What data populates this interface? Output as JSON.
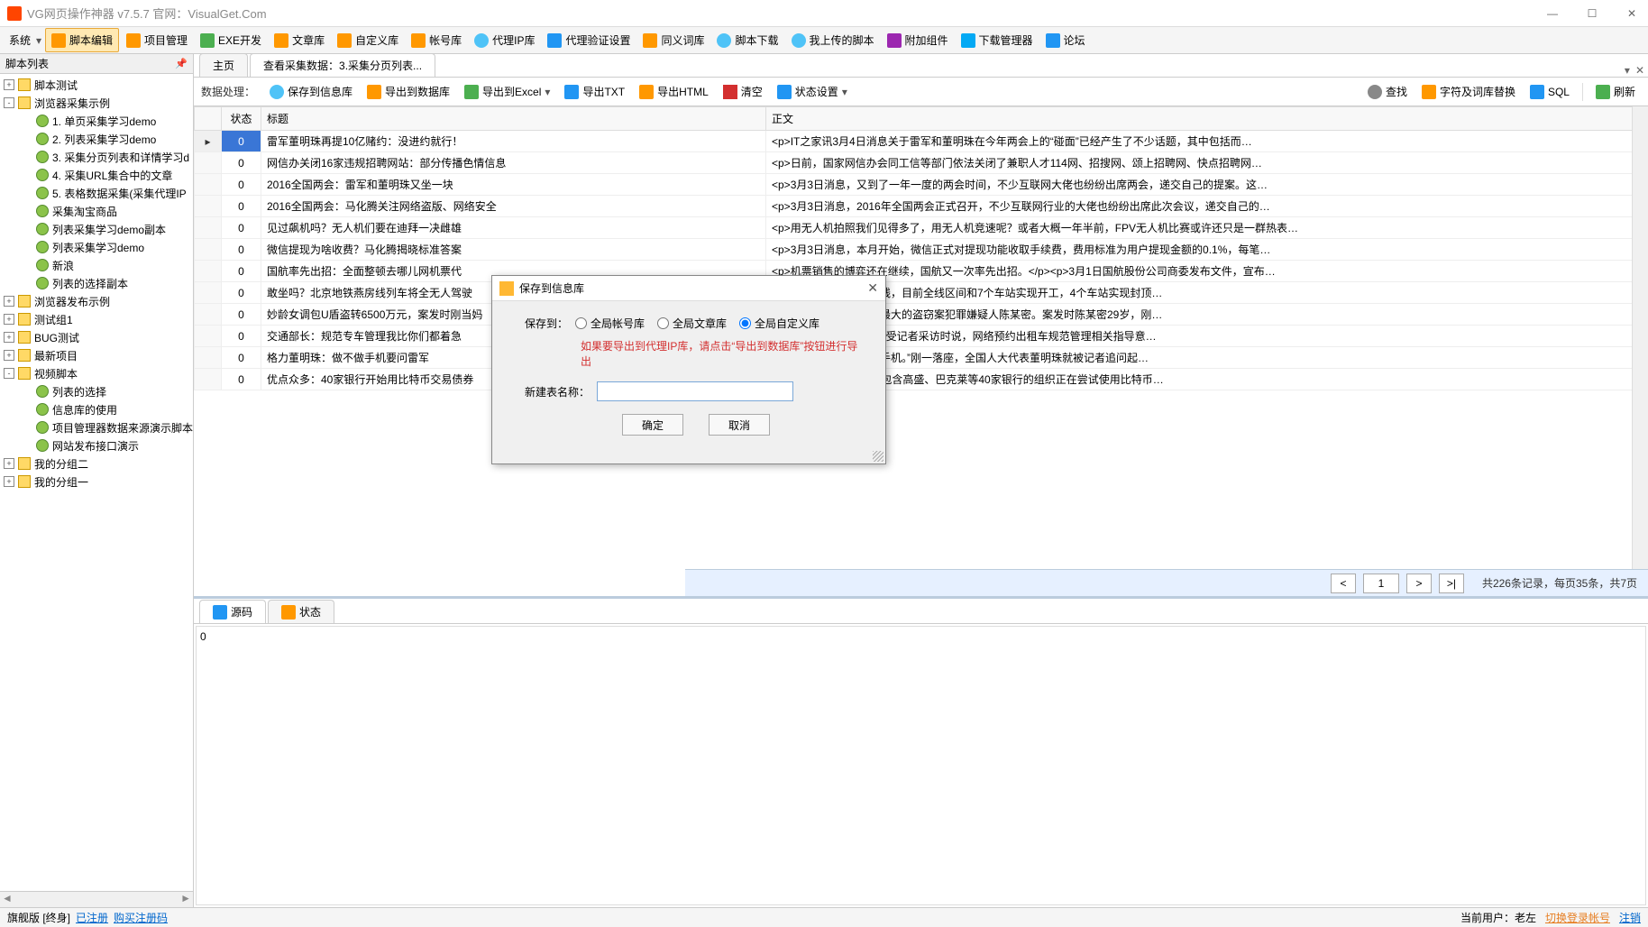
{
  "window": {
    "title": "VG网页操作神器 v7.5.7    官网：VisualGet.Com"
  },
  "menubar": {
    "system": "系统",
    "items": [
      "脚本编辑",
      "项目管理",
      "EXE开发",
      "文章库",
      "自定义库",
      "帐号库",
      "代理IP库",
      "代理验证设置",
      "同义词库",
      "脚本下载",
      "我上传的脚本",
      "附加组件",
      "下载管理器",
      "论坛"
    ]
  },
  "sidebar": {
    "title": "脚本列表",
    "nodes": [
      {
        "level": 0,
        "toggle": "+",
        "icon": "folder",
        "label": "脚本测试"
      },
      {
        "level": 0,
        "toggle": "-",
        "icon": "folder",
        "label": "浏览器采集示例"
      },
      {
        "level": 1,
        "toggle": "",
        "icon": "file",
        "label": "1. 单页采集学习demo"
      },
      {
        "level": 1,
        "toggle": "",
        "icon": "file",
        "label": "2. 列表采集学习demo"
      },
      {
        "level": 1,
        "toggle": "",
        "icon": "file",
        "label": "3. 采集分页列表和详情学习d"
      },
      {
        "level": 1,
        "toggle": "",
        "icon": "file",
        "label": "4. 采集URL集合中的文章"
      },
      {
        "level": 1,
        "toggle": "",
        "icon": "file",
        "label": "5. 表格数据采集(采集代理IP"
      },
      {
        "level": 1,
        "toggle": "",
        "icon": "file",
        "label": "采集淘宝商品"
      },
      {
        "level": 1,
        "toggle": "",
        "icon": "file",
        "label": "列表采集学习demo副本"
      },
      {
        "level": 1,
        "toggle": "",
        "icon": "file",
        "label": "列表采集学习demo"
      },
      {
        "level": 1,
        "toggle": "",
        "icon": "file",
        "label": "新浪"
      },
      {
        "level": 1,
        "toggle": "",
        "icon": "file",
        "label": "列表的选择副本"
      },
      {
        "level": 0,
        "toggle": "+",
        "icon": "folder",
        "label": "浏览器发布示例"
      },
      {
        "level": 0,
        "toggle": "+",
        "icon": "folder",
        "label": "测试组1"
      },
      {
        "level": 0,
        "toggle": "+",
        "icon": "folder",
        "label": "BUG测试"
      },
      {
        "level": 0,
        "toggle": "+",
        "icon": "folder",
        "label": "最新项目"
      },
      {
        "level": 0,
        "toggle": "-",
        "icon": "folder",
        "label": "视频脚本"
      },
      {
        "level": 1,
        "toggle": "",
        "icon": "file",
        "label": "列表的选择"
      },
      {
        "level": 1,
        "toggle": "",
        "icon": "file",
        "label": "信息库的使用"
      },
      {
        "level": 1,
        "toggle": "",
        "icon": "file",
        "label": "项目管理器数据来源演示脚本"
      },
      {
        "level": 1,
        "toggle": "",
        "icon": "file",
        "label": "网站发布接口演示"
      },
      {
        "level": 0,
        "toggle": "+",
        "icon": "folder",
        "label": "我的分组二"
      },
      {
        "level": 0,
        "toggle": "+",
        "icon": "folder",
        "label": "我的分组一"
      }
    ]
  },
  "tabs": {
    "items": [
      "主页",
      "查看采集数据：3.采集分页列表..."
    ],
    "active": 1
  },
  "toolbar": {
    "label": "数据处理：",
    "save_info": "保存到信息库",
    "export_db": "导出到数据库",
    "export_excel": "导出到Excel",
    "export_txt": "导出TXT",
    "export_html": "导出HTML",
    "clear": "清空",
    "status_set": "状态设置",
    "search": "查找",
    "replace": "字符及词库替换",
    "sql": "SQL",
    "refresh": "刷新"
  },
  "grid": {
    "columns": [
      "状态",
      "标题",
      "正文"
    ],
    "rows": [
      {
        "status": "0",
        "title": "雷军董明珠再提10亿赌约：没进约就行！",
        "body": "<p>IT之家讯3月4日消息关于雷军和董明珠在今年两会上的“碰面”已经产生了不少话题，其中包括而…"
      },
      {
        "status": "0",
        "title": "网信办关闭16家违规招聘网站：部分传播色情信息",
        "body": "<p>日前，国家网信办会同工信等部门依法关闭了兼职人才114网、招搜网、颂上招聘网、快点招聘网…"
      },
      {
        "status": "0",
        "title": "2016全国两会：雷军和董明珠又坐一块",
        "body": "<p>3月3日消息，又到了一年一度的两会时间，不少互联网大佬也纷纷出席两会，递交自己的提案。这…"
      },
      {
        "status": "0",
        "title": "2016全国两会：马化腾关注网络盗版、网络安全",
        "body": "<p>3月3日消息，2016年全国两会正式召开，不少互联网行业的大佬也纷纷出席此次会议，递交自己的…"
      },
      {
        "status": "0",
        "title": "见过飙机吗？无人机们要在迪拜一决雌雄",
        "body": "<p>用无人机拍照我们见得多了，用无人机竞速呢？或者大概一年半前，FPV无人机比赛或许还只是一群热表…"
      },
      {
        "status": "0",
        "title": "微信提现为啥收费？马化腾揭晓标准答案",
        "body": "<p>3月3日消息，本月开始，微信正式对提现功能收取手续费，费用标准为用户提现金额的0.1%，每笔…"
      },
      {
        "status": "0",
        "title": "国航率先出招：全面整顿去哪儿网机票代",
        "body": "<p>机票销售的博弈还在继续，国航又一次率先出招。</p><p>3月1日国航股份公司商委发布文件，宣布…"
      },
      {
        "status": "0",
        "title": "敢坐吗？北京地铁燕房线列车将全无人驾驶",
        "body": "试运营的北京地铁燕房线，目前全线区间和7个车站实现开工，4个车站实现封顶…"
      },
      {
        "status": "0",
        "title": "妙龄女调包U盾盗转6500万元，案发时刚当妈",
        "body": "批准逮捕晋江史上金额最大的盗窃案犯罪嫌疑人陈某密。案发时陈某密29岁，刚…"
      },
      {
        "status": "0",
        "title": "交通部长：规范专车管理我比你们都着急",
        "body": "传堂3日在人民大会堂接受记者采访时说，网络预约出租车规范管理相关指导意…"
      },
      {
        "status": "0",
        "title": "格力董明珠：做不做手机要问雷军",
        "body": "了，我们坐在一起聊聊手机。”刚一落座，全国人大代表董明珠就被记者追问起…"
      },
      {
        "status": "0",
        "title": "优点众多：40家银行开始用比特币交易债券",
        "body": "外媒体cnbc报道，一个包含高盛、巴克莱等40家银行的组织正在尝试使用比特币…"
      }
    ]
  },
  "pager": {
    "page": "1",
    "info": "共226条记录，每页35条，共7页"
  },
  "bottom": {
    "tabs": [
      "源码",
      "状态"
    ],
    "active": 0,
    "content": "0"
  },
  "statusbar": {
    "version": "旗舰版 [终身]",
    "reg": "已注册",
    "buy": "购买注册码",
    "user_label": "当前用户：",
    "username": "老左",
    "switch": "切换登录帐号",
    "logout": "注销"
  },
  "modal": {
    "title": "保存到信息库",
    "save_to_label": "保存到：",
    "radios": [
      "全局帐号库",
      "全局文章库",
      "全局自定义库"
    ],
    "selected_radio": 2,
    "warning": "如果要导出到代理IP库，请点击“导出到数据库”按钮进行导出",
    "new_table_label": "新建表名称：",
    "input_value": "",
    "ok": "确定",
    "cancel": "取消"
  }
}
